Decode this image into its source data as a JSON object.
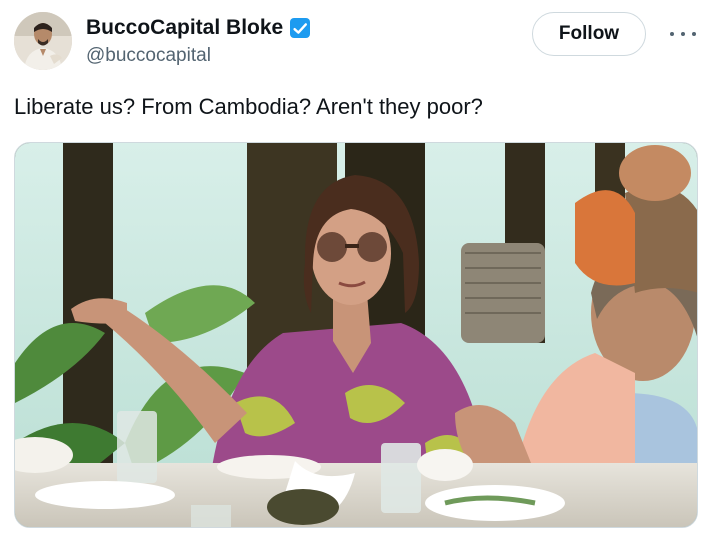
{
  "author": {
    "display_name": "BuccoCapital Bloke",
    "handle": "@buccocapital",
    "verified_icon": "verified-badge-icon",
    "verified_color": "#1d9bf0",
    "avatar_icon": "profile-photo"
  },
  "actions": {
    "follow_label": "Follow",
    "more_icon": "more-options-icon"
  },
  "tweet": {
    "text": "Liberate us? From Cambodia? Aren't they poor?"
  },
  "media": {
    "kind": "photo",
    "scene": "restaurant-dining-scene"
  },
  "colors": {
    "text_primary": "#0f1419",
    "text_secondary": "#536471",
    "border": "#cfd9de"
  }
}
